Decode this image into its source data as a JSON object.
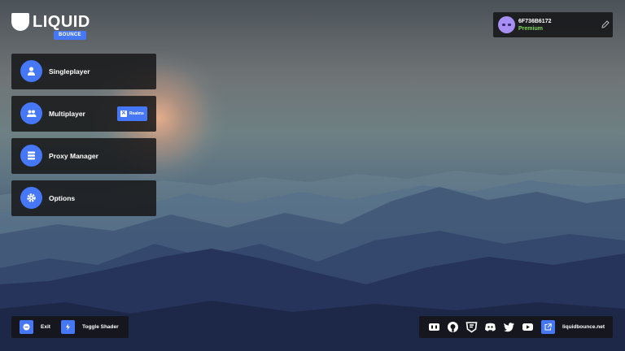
{
  "brand": {
    "name": "LIQUID",
    "badge": "BOUNCE"
  },
  "account": {
    "username": "6F736B6172",
    "tier": "Premium"
  },
  "menu": [
    {
      "label": "Singleplayer",
      "icon": "user-icon"
    },
    {
      "label": "Multiplayer",
      "icon": "users-icon",
      "extra_label": "Realms",
      "extra_icon": "realms-icon"
    },
    {
      "label": "Proxy Manager",
      "icon": "server-list-icon"
    },
    {
      "label": "Options",
      "icon": "gear-icon"
    }
  ],
  "footer_left": {
    "exit_label": "Exit",
    "shader_label": "Toggle Shader"
  },
  "footer_right": {
    "socials": [
      "guilded-icon",
      "github-icon",
      "forum-icon",
      "discord-icon",
      "twitter-icon",
      "youtube-icon"
    ],
    "website": "liquidbounce.net"
  },
  "colors": {
    "accent": "#4677f6",
    "premium": "#7ed957",
    "panel": "#161618"
  }
}
